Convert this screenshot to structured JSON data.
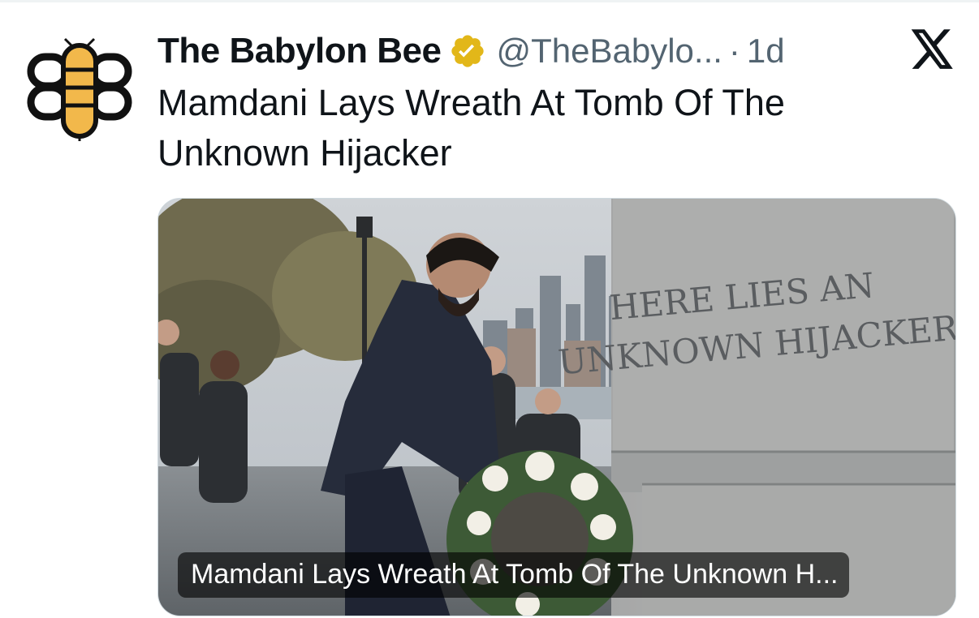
{
  "tweet": {
    "display_name": "The Babylon Bee",
    "handle": "@TheBabylo...",
    "separator": "·",
    "time": "1d",
    "text": "Mamdani Lays Wreath At Tomb Of The Unknown Hijacker"
  },
  "media": {
    "caption": "Mamdani Lays Wreath At Tomb Of The Unknown H...",
    "inscription_line1": "HERE LIES AN",
    "inscription_line2": "UNKNOWN HIJACKER"
  },
  "icons": {
    "avatar": "babylon-bee-logo",
    "verified": "verified-badge-icon",
    "platform": "x-logo-icon"
  },
  "colors": {
    "text_primary": "#0f1419",
    "text_secondary": "#536471",
    "verified_gold": "#e2b719",
    "bee_yellow": "#f2b84b"
  }
}
